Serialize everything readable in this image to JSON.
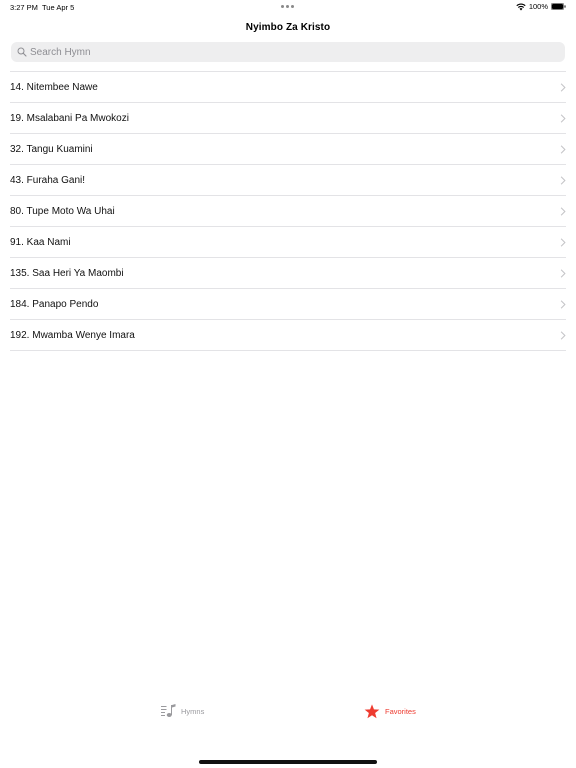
{
  "status_bar": {
    "time": "3:27 PM",
    "date": "Tue Apr 5",
    "battery": "100%"
  },
  "nav": {
    "title": "Nyimbo Za Kristo"
  },
  "search": {
    "placeholder": "Search Hymn",
    "value": ""
  },
  "hymns": [
    "14. Nitembee Nawe",
    "19. Msalabani Pa Mwokozi",
    "32. Tangu Kuamini",
    "43. Furaha Gani!",
    "80. Tupe Moto Wa Uhai",
    "91. Kaa Nami",
    "135. Saa Heri Ya Maombi",
    "184. Panapo Pendo",
    "192. Mwamba Wenye Imara"
  ],
  "tabs": {
    "hymns_label": "Hymns",
    "favorites_label": "Favorites",
    "active": "Favorites"
  },
  "colors": {
    "accent": "#ee3b30",
    "inactive": "#9a9a9e",
    "separator": "#e3e3e6",
    "search_bg": "#eeeeef"
  },
  "icons": {
    "search": "search-icon",
    "chevron": "chevron-right-icon",
    "hymns_tab": "music-list-icon",
    "favorites_tab": "star-icon",
    "wifi": "wifi-icon",
    "battery": "battery-icon"
  }
}
